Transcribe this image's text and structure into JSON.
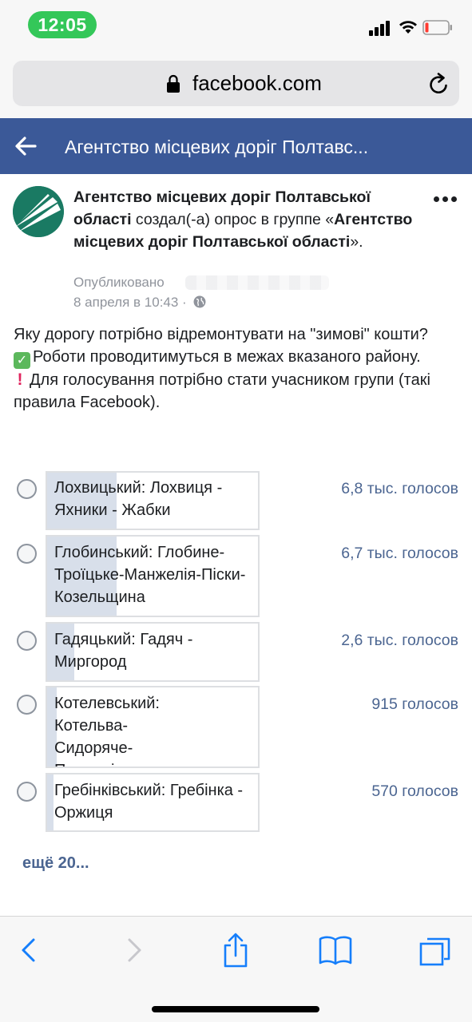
{
  "status_bar": {
    "time": "12:05"
  },
  "browser": {
    "url": "facebook.com"
  },
  "header": {
    "title": "Агентство місцевих доріг Полтавс..."
  },
  "post": {
    "author": "Агентство місцевих доріг Полтавської області",
    "action": " создал(-а) опрос в группе ",
    "group_open": "«",
    "group_name": "Агентство місцевих доріг Полтавської області",
    "group_close": "».",
    "published_label": "Опубликовано",
    "date": "8 апреля в 10:43 · ",
    "body_line1": "Яку дорогу потрібно відремонтувати на \"зимові\" кошти?",
    "body_line2": "Роботи проводитимуться в межах вказаного району.",
    "body_line3": "Для голосування потрібно стати учасником групи (такі правила Facebook)."
  },
  "poll": {
    "options": [
      {
        "label": "Лохвицький: Лохвиця - Яхники - Жабки",
        "votes": "6,8 тыс. голосов",
        "fill": 0.33
      },
      {
        "label": "Глобинський: Глобине-Троїцьке-Манжелія-Піски-Козельщина",
        "votes": "6,7 тыс. голосов",
        "fill": 0.33
      },
      {
        "label": "Гадяцький: Гадяч - Миргород",
        "votes": "2,6 тыс. голосов",
        "fill": 0.13
      },
      {
        "label": "Котелевський: Котельва-Сидоряче-Пархомівка",
        "votes": "915 голосов",
        "fill": 0.045
      },
      {
        "label": "Гребінківський: Гребінка - Оржиця",
        "votes": "570 голосов",
        "fill": 0.03
      }
    ],
    "more_label": "ещё 20..."
  },
  "colors": {
    "fb_header": "#3b5998",
    "vote_text": "#4b6591",
    "poll_fill": "#d8dfea",
    "time_pill": "#34c759"
  },
  "icons": {
    "status": [
      "signal-icon",
      "wifi-icon",
      "battery-icon"
    ],
    "toolbar": [
      "back-icon",
      "forward-icon",
      "share-icon",
      "bookmarks-icon",
      "tabs-icon"
    ]
  }
}
